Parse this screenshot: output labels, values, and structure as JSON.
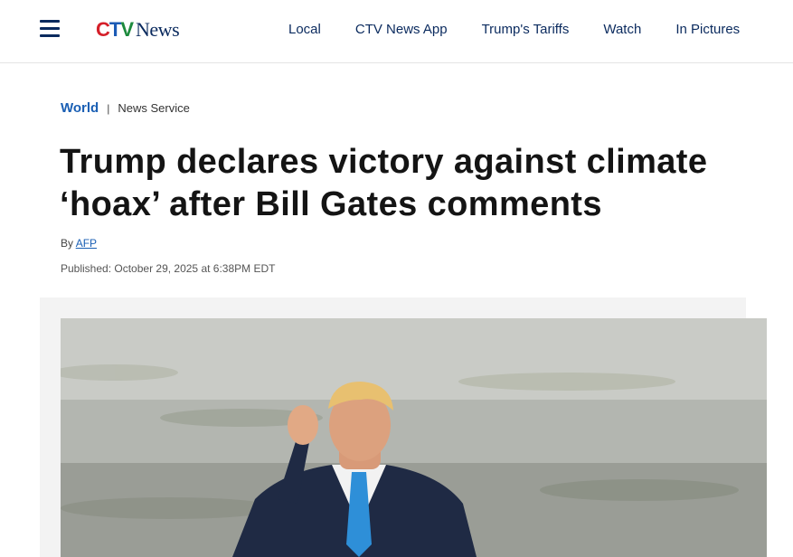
{
  "header": {
    "logo": {
      "brand": "CTV",
      "product": "News"
    },
    "nav": [
      "Local",
      "CTV News App",
      "Trump's Tariffs",
      "Watch",
      "In Pictures"
    ]
  },
  "article": {
    "breadcrumb": {
      "section": "World",
      "separator": "|",
      "source": "News Service"
    },
    "title": "Trump declares victory against climate ‘hoax’ after Bill Gates comments",
    "byline_prefix": "By",
    "author": "AFP",
    "published": "Published: October 29, 2025 at 6:38PM EDT"
  },
  "colors": {
    "logo_red": "#d5202a",
    "logo_blue": "#1c5bb6",
    "logo_green": "#1d8a3d",
    "nav_text": "#0a2a5e",
    "link": "#1a5fb4"
  },
  "icons": {
    "menu": "hamburger-menu-icon"
  }
}
